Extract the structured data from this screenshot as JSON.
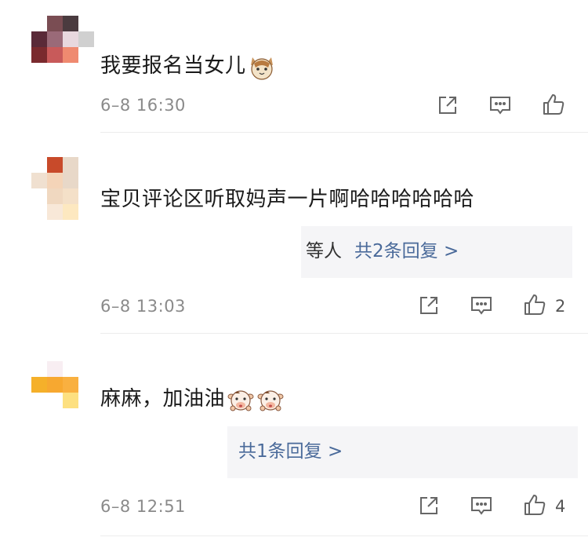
{
  "comments": [
    {
      "text": "我要报名当女儿",
      "emoji_icons": [
        "cat-emoji-icon"
      ],
      "time": "6–8 16:30",
      "likes": ""
    },
    {
      "text": "宝贝评论区听取妈声一片啊哈哈哈哈哈哈",
      "reply_who": "等人",
      "reply_link": "共2条回复 >",
      "time": "6–8 13:03",
      "likes": "2"
    },
    {
      "text": "麻麻，加油油",
      "emoji_icons": [
        "cow-emoji-icon",
        "cow-emoji-icon"
      ],
      "reply_link": "共1条回复 >",
      "time": "6–8 12:51",
      "likes": "4"
    }
  ],
  "icons": {
    "share": "share-icon",
    "comment": "comment-icon",
    "like": "thumbs-up-icon"
  },
  "colors": {
    "reply_link": "#4a6a9a",
    "reply_bg": "#f5f5f7",
    "meta": "#8a8a8a"
  }
}
